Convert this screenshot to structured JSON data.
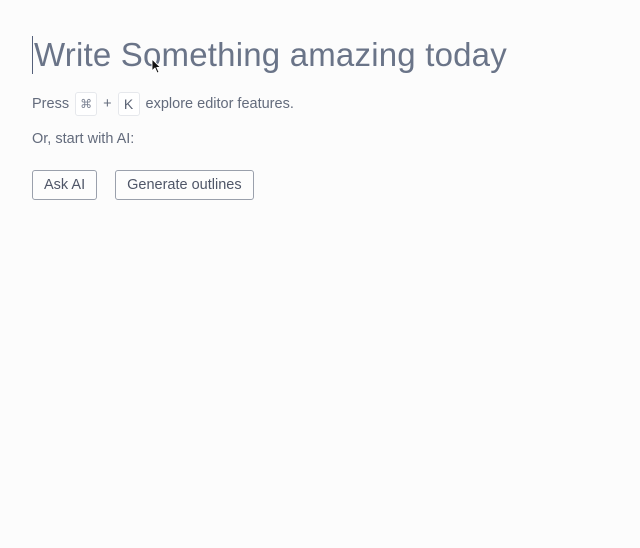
{
  "editor": {
    "title": "Write Something amazing today",
    "hint": {
      "prefix": "Press",
      "key1": "⌘",
      "plus": "+",
      "key2": "K",
      "suffix": "explore editor features."
    },
    "ai_label": "Or, start with AI:",
    "buttons": {
      "ask_ai": "Ask AI",
      "generate_outlines": "Generate outlines"
    }
  },
  "colors": {
    "background": "#fcfcfc",
    "title_text": "#6a7488",
    "body_text": "#636b7c",
    "button_border": "#9aa0ac"
  },
  "icons": {
    "cursor": "mouse-pointer-icon"
  }
}
